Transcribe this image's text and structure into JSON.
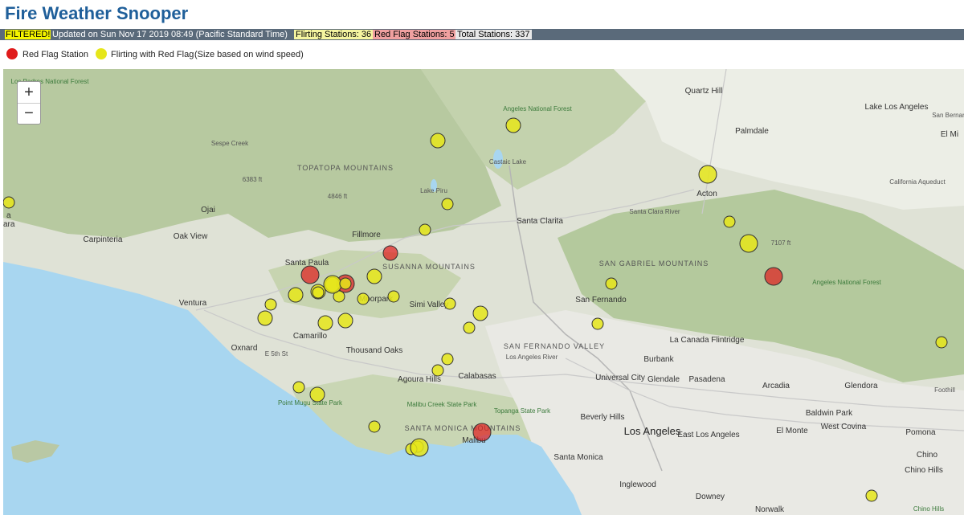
{
  "header": {
    "title": "Fire Weather Snooper"
  },
  "status": {
    "filtered": "FILTERED!",
    "updated": "Updated on Sun Nov 17 2019 08:49 (Pacific Standard Time)",
    "flirting": "Flirting Stations: 36",
    "red_flag": "Red Flag Stations: 5",
    "total": "Total Stations: 337"
  },
  "legend": {
    "red_label": "Red Flag Station",
    "yellow_label": "Flirting with Red Flag",
    "size_note": "(Size based on wind speed)",
    "red_color": "#e01b1b",
    "yellow_color": "#e6e61a"
  },
  "controls": {
    "zoom_in": "+",
    "zoom_out": "−"
  },
  "map": {
    "labels": {
      "los_padres": "Los Padres National Forest",
      "angeles_nf_north": "Angeles National Forest",
      "angeles_nf_east": "Angeles National Forest",
      "quartz_hill": "Quartz Hill",
      "lake_los_angeles": "Lake Los Angeles",
      "palmdale": "Palmdale",
      "el_mirage": "El Mi",
      "topatopa": "TOPATOPA MOUNTAINS",
      "sespe_creek": "Sespe Creek",
      "castaic_lake": "Castaic Lake",
      "lake_piru": "Lake Piru",
      "acton": "Acton",
      "california_aqueduct": "California Aqueduct",
      "ojai": "Ojai",
      "santa_clarita": "Santa Clarita",
      "santa_clara_river": "Santa Clara River",
      "carpinteria": "Carpinteria",
      "oak_view": "Oak View",
      "fillmore": "Fillmore",
      "santa_paula": "Santa Paula",
      "susanna": "SUSANNA MOUNTAINS",
      "san_gabriel_mtns": "SAN GABRIEL MOUNTAINS",
      "ventura": "Ventura",
      "moorpark": "Moorpark",
      "simi_valley": "Simi Valley",
      "san_fernando": "San Fernando",
      "camarillo": "Camarillo",
      "oxnard": "Oxnard",
      "thousand_oaks": "Thousand Oaks",
      "sf_valley": "SAN FERNANDO VALLEY",
      "la_canada": "La Canada Flintridge",
      "burbank": "Burbank",
      "agoura_hills": "Agoura Hills",
      "calabasas": "Calabasas",
      "universal_city": "Universal City",
      "glendale": "Glendale",
      "pasadena": "Pasadena",
      "arcadia": "Arcadia",
      "glendora": "Glendora",
      "foothill": "Foothill",
      "point_mugu": "Point Mugu State Park",
      "malibu_creek": "Malibu Creek State Park",
      "topanga": "Topanga State Park",
      "santa_monica_mtns": "SANTA MONICA MOUNTAINS",
      "beverly_hills": "Beverly Hills",
      "baldwin_park": "Baldwin Park",
      "west_covina": "West Covina",
      "malibu": "Malibu",
      "los_angeles": "Los Angeles",
      "east_los_angeles": "East Los Angeles",
      "el_monte": "El Monte",
      "pomona": "Pomona",
      "santa_monica": "Santa Monica",
      "chino": "Chino",
      "chino_hills": "Chino Hills",
      "inglewood": "Inglewood",
      "downey": "Downey",
      "norwalk": "Norwalk",
      "chino_hills_sp": "Chino Hills",
      "elev_6383": "6383 ft",
      "elev_4846": "4846 ft",
      "elev_7107": "7107 ft",
      "los_angeles_river": "Los Angeles River",
      "e_5th_st": "E 5th St",
      "san_bernardino": "San Bernardino",
      "ra": "a",
      "ara": "ara"
    },
    "stations": [
      {
        "type": "yellow",
        "wind": 2
      },
      {
        "type": "yellow",
        "wind": 3
      },
      {
        "type": "yellow",
        "wind": 3
      },
      {
        "type": "yellow",
        "wind": 2
      },
      {
        "type": "yellow",
        "wind": 4
      },
      {
        "type": "yellow",
        "wind": 2
      },
      {
        "type": "yellow",
        "wind": 2
      },
      {
        "type": "yellow",
        "wind": 4
      },
      {
        "type": "red",
        "wind": 3
      },
      {
        "type": "red",
        "wind": 4
      },
      {
        "type": "red",
        "wind": 4
      },
      {
        "type": "yellow",
        "wind": 3
      },
      {
        "type": "yellow",
        "wind": 3
      },
      {
        "type": "yellow",
        "wind": 3
      },
      {
        "type": "yellow",
        "wind": 2
      },
      {
        "type": "yellow",
        "wind": 2
      },
      {
        "type": "yellow",
        "wind": 3
      },
      {
        "type": "yellow",
        "wind": 2
      },
      {
        "type": "yellow",
        "wind": 3
      },
      {
        "type": "yellow",
        "wind": 3
      },
      {
        "type": "yellow",
        "wind": 3
      },
      {
        "type": "yellow",
        "wind": 2
      },
      {
        "type": "yellow",
        "wind": 2
      },
      {
        "type": "yellow",
        "wind": 2
      },
      {
        "type": "yellow",
        "wind": 3
      },
      {
        "type": "yellow",
        "wind": 2
      },
      {
        "type": "yellow",
        "wind": 2
      },
      {
        "type": "yellow",
        "wind": 2
      },
      {
        "type": "yellow",
        "wind": 2
      },
      {
        "type": "yellow",
        "wind": 2
      },
      {
        "type": "yellow",
        "wind": 3
      },
      {
        "type": "yellow",
        "wind": 2
      },
      {
        "type": "red",
        "wind": 4
      },
      {
        "type": "yellow",
        "wind": 2
      },
      {
        "type": "yellow",
        "wind": 2
      },
      {
        "type": "yellow",
        "wind": 2
      },
      {
        "type": "yellow",
        "wind": 4
      },
      {
        "type": "yellow",
        "wind": 2
      },
      {
        "type": "yellow",
        "wind": 4
      },
      {
        "type": "red",
        "wind": 4
      },
      {
        "type": "yellow",
        "wind": 2
      },
      {
        "type": "yellow",
        "wind": 2
      }
    ]
  }
}
